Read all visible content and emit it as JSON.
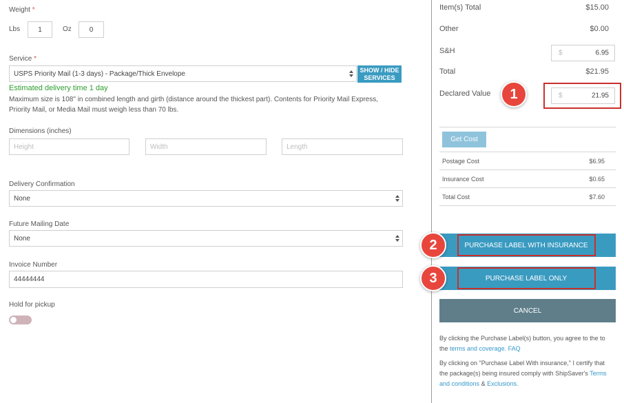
{
  "weight": {
    "label": "Weight",
    "required_mark": "*",
    "lbs_label": "Lbs",
    "lbs_value": "1",
    "oz_label": "Oz",
    "oz_value": "0"
  },
  "service": {
    "label": "Service",
    "required_mark": "*",
    "selected": "USPS Priority Mail (1-3 days) - Package/Thick Envelope",
    "toggle_button": "SHOW / HIDE SERVICES",
    "delivery_estimate": "Estimated delivery time 1 day",
    "info": "Maximum size is 108\" in combined length and girth (distance around the thickest part). Contents for Priority Mail Express, Priority Mail, or Media Mail must weigh less than 70 lbs."
  },
  "dimensions": {
    "label": "Dimensions (inches)",
    "height_placeholder": "Height",
    "width_placeholder": "Width",
    "length_placeholder": "Length"
  },
  "delivery_confirmation": {
    "label": "Delivery Confirmation",
    "selected": "None"
  },
  "future_mailing_date": {
    "label": "Future Mailing Date",
    "selected": "None"
  },
  "invoice": {
    "label": "Invoice Number",
    "value": "44444444"
  },
  "hold_for_pickup": {
    "label": "Hold for pickup",
    "enabled": false
  },
  "summary": {
    "items_total_label": "Item(s) Total",
    "items_total_value": "$15.00",
    "other_label": "Other",
    "other_value": "$0.00",
    "sh_label": "S&H",
    "sh_currency": "$",
    "sh_value": "6.95",
    "total_label": "Total",
    "total_value": "$21.95",
    "declared_label": "Declared Value",
    "declared_currency": "$",
    "declared_value": "21.95"
  },
  "costs": {
    "get_cost_button": "Get Cost",
    "postage_label": "Postage Cost",
    "postage_value": "$6.95",
    "insurance_label": "Insurance Cost",
    "insurance_value": "$0.65",
    "total_label": "Total Cost",
    "total_value": "$7.60"
  },
  "actions": {
    "purchase_with_insurance": "PURCHASE LABEL WITH INSURANCE",
    "purchase_only": "PURCHASE LABEL ONLY",
    "cancel": "CANCEL"
  },
  "notes": {
    "note1_text": "By clicking the Purchase Label(s) button, you agree to the to the",
    "note1_link1": "terms and coverage.",
    "note1_link2": "FAQ",
    "note2_text": "By clicking on \"Purchase Label With insurance,\" I certify that the package(s) being insured comply with ShipSaver's",
    "note2_link1": "Terms and conditions",
    "note2_amp": "&",
    "note2_link2": "Exclusions."
  },
  "callouts": [
    "1",
    "2",
    "3"
  ],
  "colors": {
    "primary": "#3a9bc1",
    "secondary": "#5f7e8a",
    "get_cost": "#8fc3dc",
    "callout": "#e8463d",
    "success": "#2e9e2e"
  }
}
